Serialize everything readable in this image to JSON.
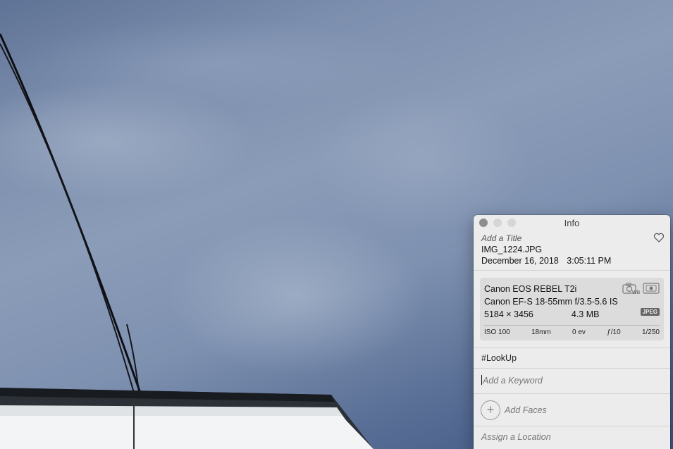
{
  "window": {
    "title": "Info"
  },
  "header": {
    "add_title_placeholder": "Add a Title",
    "filename": "IMG_1224.JPG",
    "date": "December 16, 2018",
    "time": "3:05:11 PM",
    "favorite_icon": "heart-icon"
  },
  "exif": {
    "camera": "Canon EOS REBEL T2i",
    "lens": "Canon EF-S 18-55mm f/3.5-5.6 IS",
    "dimensions": "5184 × 3456",
    "file_size": "4.3 MB",
    "format_badge": "JPEG",
    "icons": [
      "camera-wb-icon",
      "camera-metering-icon"
    ],
    "stats": {
      "iso": "ISO 100",
      "focal_length": "18mm",
      "exposure_bias": "0 ev",
      "aperture": "ƒ/10",
      "shutter": "1/250"
    }
  },
  "keywords": {
    "tag": "#LookUp",
    "add_placeholder": "Add a Keyword"
  },
  "faces": {
    "label": "Add Faces"
  },
  "location": {
    "placeholder": "Assign a Location"
  }
}
